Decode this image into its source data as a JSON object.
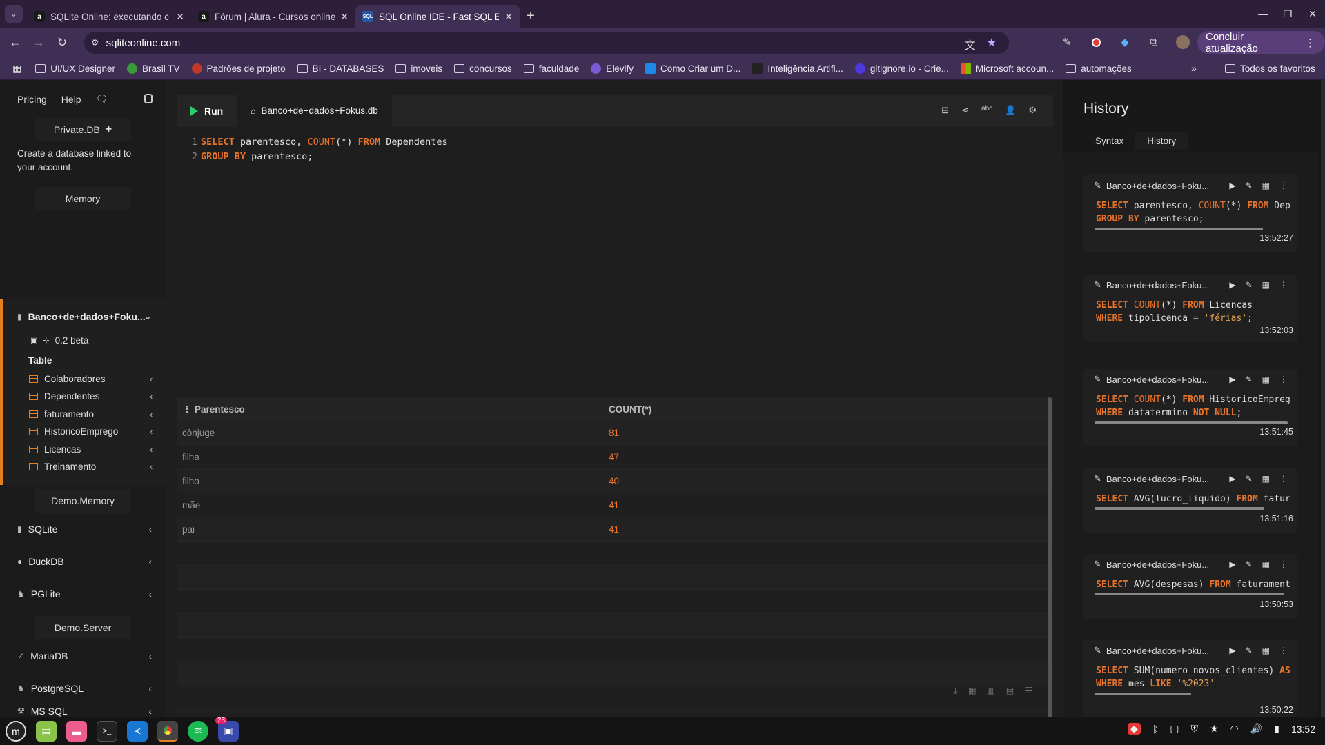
{
  "browser": {
    "tabs": [
      {
        "title": "SQLite Online: executando c",
        "favicon": "a"
      },
      {
        "title": "Fórum | Alura - Cursos online",
        "favicon": "a"
      },
      {
        "title": "SQL Online IDE - Fast SQL Ed",
        "favicon": "SQL"
      }
    ],
    "url": "sqliteonline.com",
    "update_button": "Concluir atualização",
    "bookmarks": [
      "UI/UX Designer",
      "Brasil TV",
      "Padrões de projeto",
      "BI - DATABASES",
      "imoveis",
      "concursos",
      "faculdade",
      "Elevify",
      "Como Criar um D...",
      "Inteligência Artifi...",
      "gitignore.io - Crie...",
      "Microsoft accoun...",
      "automações"
    ],
    "all_favorites": "Todos os favoritos"
  },
  "sidebar": {
    "pricing": "Pricing",
    "help": "Help",
    "private_db": "Private.DB",
    "create_text": "Create a database linked to your account.",
    "memory": "Memory",
    "active_db": "Banco+de+dados+Foku...",
    "version": "0.2 beta",
    "table_label": "Table",
    "tables": [
      "Colaboradores",
      "Dependentes",
      "faturamento",
      "HistoricoEmprego",
      "Licencas",
      "Treinamento"
    ],
    "demo_memory": "Demo.Memory",
    "memory_engines": [
      "SQLite",
      "DuckDB",
      "PGLite"
    ],
    "demo_server": "Demo.Server",
    "server_engines": [
      "MariaDB",
      "PostgreSQL",
      "MS SQL"
    ]
  },
  "editor": {
    "run_label": "Run",
    "db_tab": "Banco+de+dados+Fokus.db"
  },
  "results": {
    "columns": [
      "Parentesco",
      "COUNT(*)"
    ],
    "rows": [
      [
        "cônjuge",
        "81"
      ],
      [
        "filha",
        "47"
      ],
      [
        "filho",
        "40"
      ],
      [
        "mãe",
        "41"
      ],
      [
        "pai",
        "41"
      ]
    ]
  },
  "history": {
    "title": "History",
    "tabs": [
      "Syntax",
      "History"
    ],
    "db_label": "Banco+de+dados+Foku...",
    "entries": [
      {
        "time": "13:52:27",
        "bar": 0.87
      },
      {
        "time": "13:52:03",
        "bar": 0
      },
      {
        "time": "13:51:45",
        "bar": 1.0
      },
      {
        "time": "13:51:16",
        "bar": 0.88
      },
      {
        "time": "13:50:53",
        "bar": 0.98
      },
      {
        "time": "13:50:22",
        "bar": 0.5
      }
    ]
  },
  "taskbar": {
    "clock": "13:52",
    "badge": "23"
  },
  "colors": {
    "accent": "#e67e22",
    "run": "#2ecc71",
    "chrome": "#3f2f55"
  }
}
